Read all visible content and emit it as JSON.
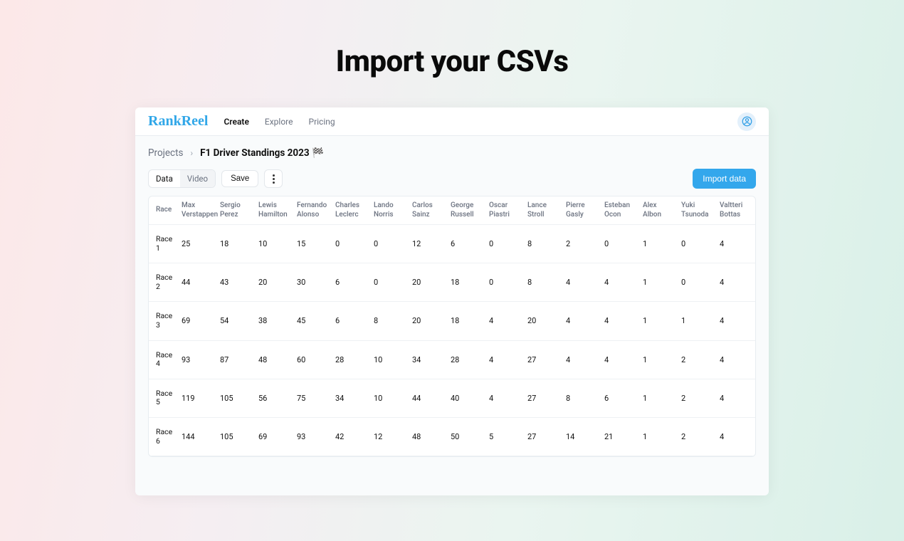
{
  "hero": {
    "title": "Import your CSVs"
  },
  "brand": "RankReel",
  "nav": [
    {
      "label": "Create",
      "active": true
    },
    {
      "label": "Explore",
      "active": false
    },
    {
      "label": "Pricing",
      "active": false
    }
  ],
  "breadcrumb": {
    "root": "Projects",
    "current": "F1 Driver Standings 2023 🏁"
  },
  "toolbar": {
    "tab_data": "Data",
    "tab_video": "Video",
    "save": "Save",
    "import": "Import data"
  },
  "table": {
    "row_header_label": "Race",
    "columns": [
      "Max Verstappen",
      "Sergio Perez",
      "Lewis Hamilton",
      "Fernando Alonso",
      "Charles Leclerc",
      "Lando Norris",
      "Carlos Sainz",
      "George Russell",
      "Oscar Piastri",
      "Lance Stroll",
      "Pierre Gasly",
      "Esteban Ocon",
      "Alex Albon",
      "Yuki Tsunoda",
      "Valtteri Bottas"
    ],
    "rows": [
      {
        "label": "Race 1",
        "values": [
          "25",
          "18",
          "10",
          "15",
          "0",
          "0",
          "12",
          "6",
          "0",
          "8",
          "2",
          "0",
          "1",
          "0",
          "4"
        ]
      },
      {
        "label": "Race 2",
        "values": [
          "44",
          "43",
          "20",
          "30",
          "6",
          "0",
          "20",
          "18",
          "0",
          "8",
          "4",
          "4",
          "1",
          "0",
          "4"
        ]
      },
      {
        "label": "Race 3",
        "values": [
          "69",
          "54",
          "38",
          "45",
          "6",
          "8",
          "20",
          "18",
          "4",
          "20",
          "4",
          "4",
          "1",
          "1",
          "4"
        ]
      },
      {
        "label": "Race 4",
        "values": [
          "93",
          "87",
          "48",
          "60",
          "28",
          "10",
          "34",
          "28",
          "4",
          "27",
          "4",
          "4",
          "1",
          "2",
          "4"
        ]
      },
      {
        "label": "Race 5",
        "values": [
          "119",
          "105",
          "56",
          "75",
          "34",
          "10",
          "44",
          "40",
          "4",
          "27",
          "8",
          "6",
          "1",
          "2",
          "4"
        ]
      },
      {
        "label": "Race 6",
        "values": [
          "144",
          "105",
          "69",
          "93",
          "42",
          "12",
          "48",
          "50",
          "5",
          "27",
          "14",
          "21",
          "1",
          "2",
          "4"
        ]
      }
    ]
  }
}
